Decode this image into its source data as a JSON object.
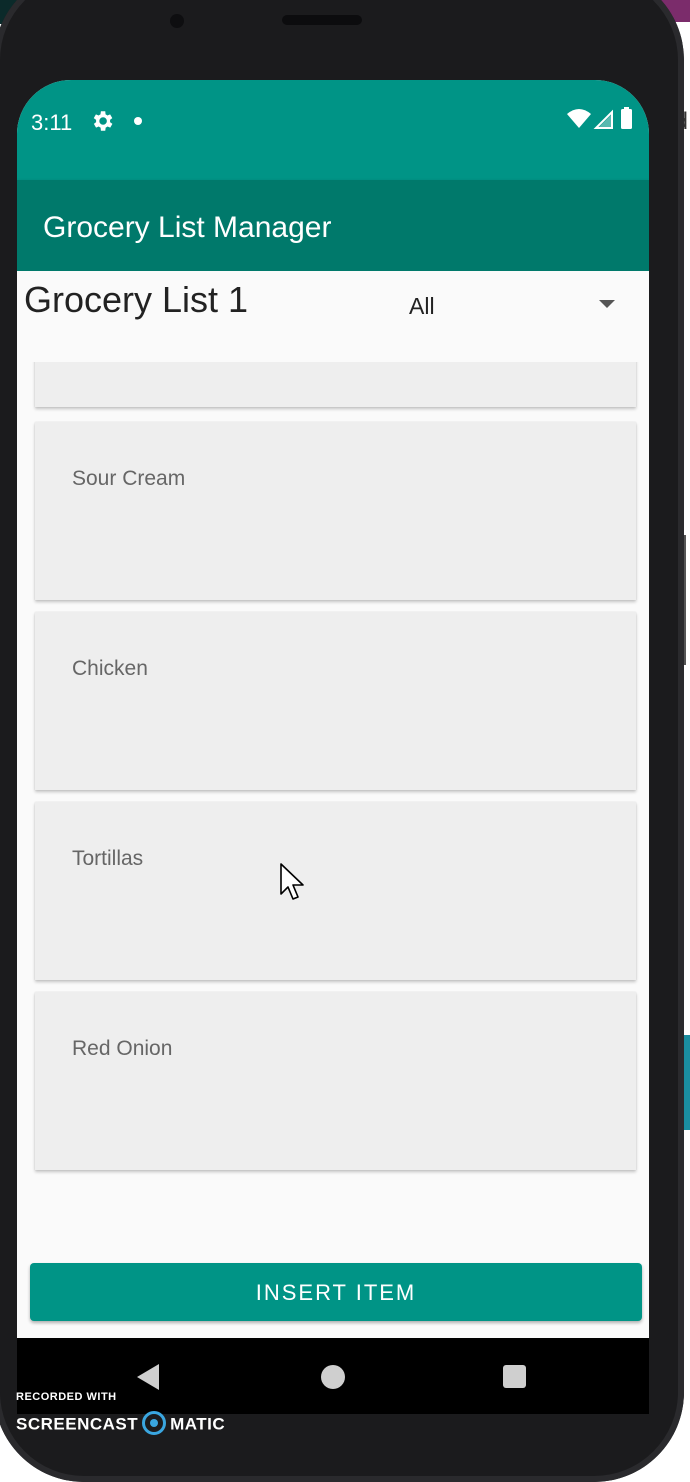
{
  "status_bar": {
    "time": "3:11"
  },
  "app_bar": {
    "title": "Grocery List Manager"
  },
  "header": {
    "list_name": "Grocery List 1",
    "filter_selected": "All"
  },
  "items": [
    {
      "label": ""
    },
    {
      "label": "Sour Cream"
    },
    {
      "label": "Chicken"
    },
    {
      "label": "Tortillas"
    },
    {
      "label": "Red Onion"
    }
  ],
  "actions": {
    "insert_label": "INSERT ITEM"
  },
  "watermark": {
    "line1": "RECORDED WITH",
    "brand_left": "SCREENCAST",
    "brand_right": "MATIC"
  },
  "colors": {
    "status_bar": "#009486",
    "app_bar": "#00796b",
    "button": "#009486"
  }
}
